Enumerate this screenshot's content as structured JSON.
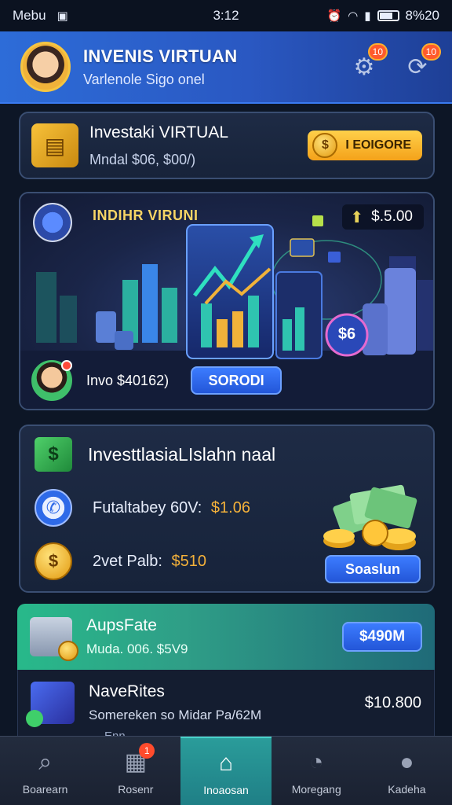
{
  "status_bar": {
    "carrier": "Mebu",
    "time": "3:12",
    "battery": "8%20"
  },
  "header": {
    "title": "INVENIS VIRTUAN",
    "subtitle": "Varlenole Sigo onel",
    "icons": [
      "settings-gear-icon",
      "refresh-icon"
    ],
    "badges": [
      "10",
      "10"
    ]
  },
  "card_investment": {
    "title": "Investaki VIRTUAL",
    "subtitle": "Mndal $06, $00/)",
    "button_label": "I EOIGORE",
    "button_icon": "$"
  },
  "hero": {
    "title": "INDIHR VIRUNI",
    "price": "$.5.00",
    "user_label": "Invo $40162)",
    "button_label": "SORODI",
    "coin_label": "$6"
  },
  "card_summary": {
    "title": "InvesttlasiaLIslahn naal",
    "rows": [
      {
        "label": "Futaltabey 60V:",
        "value": "$1.06",
        "icon": "phone-coin-icon"
      },
      {
        "label": "2vet Palb:",
        "value": "$510",
        "icon": "dollar-coin-icon"
      }
    ],
    "button_label": "Soaslun"
  },
  "card_green": {
    "title": "AupsFate",
    "subtitle": "Muda. 006. $5V9",
    "button_label": "$490M"
  },
  "card_list": {
    "title": "NaveRites",
    "subtitle": "Somereken so Midar Pa/62M",
    "value": "$10.800",
    "peek": "Enn"
  },
  "bottom_nav": [
    {
      "label": "Boarearn",
      "icon": "search-icon"
    },
    {
      "label": "Rosenr",
      "icon": "document-icon",
      "badge": "1"
    },
    {
      "label": "Inoaosan",
      "icon": "home-icon",
      "active": true
    },
    {
      "label": "Moregang",
      "icon": "analytics-icon"
    },
    {
      "label": "Kadeha",
      "icon": "profile-icon"
    }
  ],
  "colors": {
    "accent_blue": "#2d6cd8",
    "gold": "#f4a21a",
    "green": "#28b98a",
    "background": "#0d1626"
  }
}
